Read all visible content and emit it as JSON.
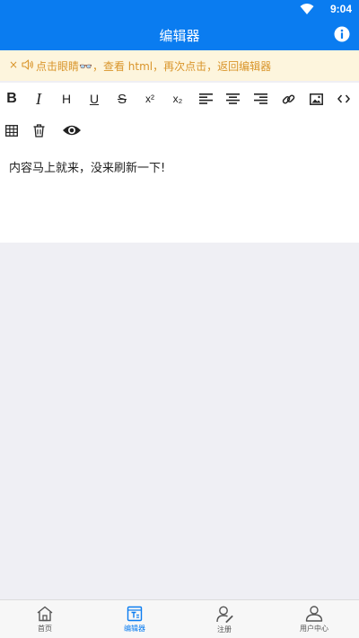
{
  "status_bar": {
    "time": "9:04"
  },
  "nav": {
    "title": "编辑器"
  },
  "notice": {
    "close_label": "×",
    "text": "点击眼睛👓，查看 html，再次点击，返回编辑器"
  },
  "toolbar": {
    "items": [
      {
        "icon": "bold-icon",
        "label": "B"
      },
      {
        "icon": "italic-icon",
        "label": "I"
      },
      {
        "icon": "heading-icon",
        "label": "H"
      },
      {
        "icon": "underline-icon",
        "label": "U"
      },
      {
        "icon": "strikethrough-icon",
        "label": "S"
      },
      {
        "icon": "superscript-icon",
        "label": "x²"
      },
      {
        "icon": "subscript-icon",
        "label": "x₂"
      },
      {
        "icon": "align-left-icon"
      },
      {
        "icon": "align-center-icon"
      },
      {
        "icon": "align-right-icon"
      },
      {
        "icon": "link-icon"
      },
      {
        "icon": "image-icon"
      },
      {
        "icon": "code-icon"
      },
      {
        "icon": "table-icon"
      },
      {
        "icon": "trash-icon"
      },
      {
        "icon": "eye-icon"
      }
    ]
  },
  "editor": {
    "content": "内容马上就来，没来刷新一下!"
  },
  "tabbar": {
    "tabs": [
      {
        "label": "首页",
        "icon": "home-icon"
      },
      {
        "label": "编辑器",
        "icon": "editor-icon",
        "active": true
      },
      {
        "label": "注册",
        "icon": "register-icon"
      },
      {
        "label": "用户中心",
        "icon": "user-center-icon"
      }
    ]
  },
  "colors": {
    "primary": "#0a7cf0",
    "notice_bg": "#fdf5dd",
    "notice_text": "#d9952b",
    "background": "#efeff4"
  }
}
